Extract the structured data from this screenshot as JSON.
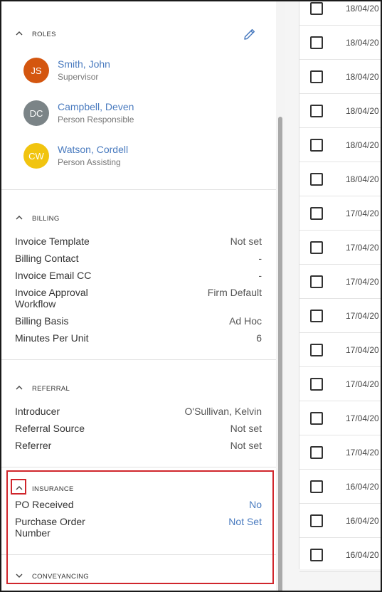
{
  "roles": {
    "title": "ROLES",
    "people": [
      {
        "initials": "JS",
        "name": "Smith, John",
        "role": "Supervisor",
        "color": "#d4560f"
      },
      {
        "initials": "DC",
        "name": "Campbell, Deven",
        "role": "Person Responsible",
        "color": "#7b8487"
      },
      {
        "initials": "CW",
        "name": "Watson, Cordell",
        "role": "Person Assisting",
        "color": "#f1c40f"
      }
    ],
    "edit_icon": "pencil-icon"
  },
  "billing": {
    "title": "BILLING",
    "rows": [
      {
        "label": "Invoice Template",
        "value": "Not set"
      },
      {
        "label": "Billing Contact",
        "value": "-"
      },
      {
        "label": "Invoice Email CC",
        "value": "-"
      },
      {
        "label": "Invoice Approval Workflow",
        "value": "Firm Default"
      },
      {
        "label": "Billing Basis",
        "value": "Ad Hoc"
      },
      {
        "label": "Minutes Per Unit",
        "value": "6"
      }
    ]
  },
  "referral": {
    "title": "REFERRAL",
    "rows": [
      {
        "label": "Introducer",
        "value": "O'Sullivan, Kelvin"
      },
      {
        "label": "Referral Source",
        "value": "Not set"
      },
      {
        "label": "Referrer",
        "value": "Not set"
      }
    ]
  },
  "insurance": {
    "title": "INSURANCE",
    "rows": [
      {
        "label": "PO Received",
        "value": "No"
      },
      {
        "label": "Purchase Order Number",
        "value": "Not Set"
      }
    ]
  },
  "conveyancing": {
    "title": "CONVEYANCING"
  },
  "list": {
    "dates": [
      "18/04/20",
      "18/04/20",
      "18/04/20",
      "18/04/20",
      "18/04/20",
      "18/04/20",
      "17/04/20",
      "17/04/20",
      "17/04/20",
      "17/04/20",
      "17/04/20",
      "17/04/20",
      "17/04/20",
      "17/04/20",
      "16/04/20",
      "16/04/20",
      "16/04/20"
    ]
  },
  "colors": {
    "link": "#4a7bbf",
    "highlight": "#d0262c"
  }
}
